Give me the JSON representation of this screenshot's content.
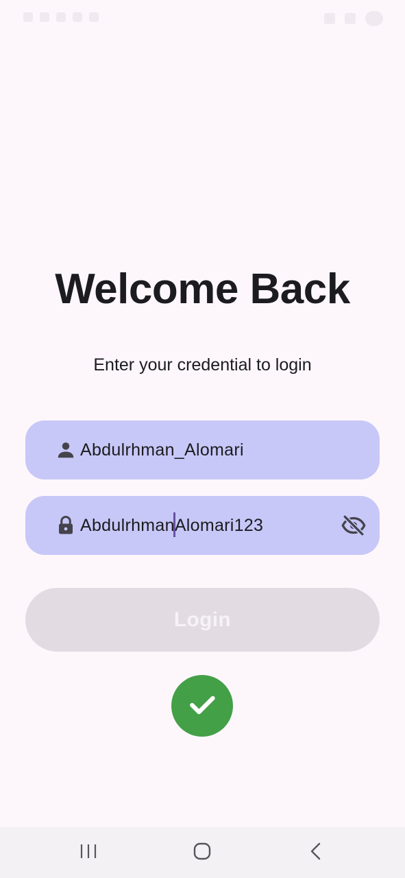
{
  "status_bar": {
    "left_icons": [
      "notification-icon",
      "notification-icon",
      "notification-icon",
      "notification-icon",
      "notification-icon",
      "dot-icon"
    ],
    "right_icons": [
      "mute-icon",
      "wifi-icon",
      "battery-icon"
    ]
  },
  "header": {
    "title": "Welcome Back",
    "subtitle": "Enter your credential to login"
  },
  "form": {
    "username": {
      "icon": "person-icon",
      "value": "Abdulrhman_Alomari"
    },
    "password": {
      "icon": "lock-icon",
      "value_before_caret": "Abdulrhman",
      "value_after_caret": "Alomari123",
      "toggle_icon": "visibility-off-icon"
    },
    "login_label": "Login"
  },
  "success": {
    "icon": "check-icon",
    "color": "#43a047"
  },
  "colors": {
    "field_background": "#c7c8f8",
    "page_background": "#fdf7fc",
    "disabled_button": "#e2dce2",
    "caret": "#6750a4"
  },
  "nav_bar": {
    "buttons": [
      "recents-icon",
      "home-icon",
      "back-icon"
    ]
  }
}
